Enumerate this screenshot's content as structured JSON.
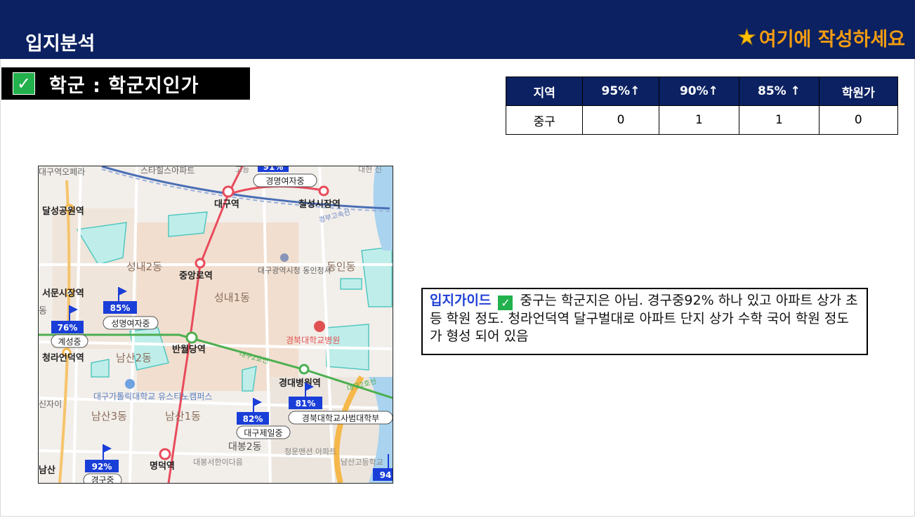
{
  "header": {
    "title": "입지분석",
    "note": "여기에 작성하세요",
    "bg_color": "#0b2161",
    "note_color": "#f39c12",
    "star_icon": "star-icon"
  },
  "section": {
    "label": "학군 : 학군지인가",
    "check_icon": "checkmark-icon"
  },
  "stats_table": {
    "headers": [
      "지역",
      "95%↑",
      "90%↑",
      "85% ↑",
      "학원가"
    ],
    "rows": [
      [
        "중구",
        "0",
        "1",
        "1",
        "0"
      ]
    ]
  },
  "map": {
    "stations": [
      "대구역",
      "칠성시장역",
      "달성공원역",
      "중앙로역",
      "서문시장역",
      "반월당역",
      "청라언덕역",
      "경대병원역",
      "명덕역"
    ],
    "districts": [
      "성내2동",
      "성내1동",
      "동인동",
      "남산2동",
      "남산3동",
      "남산1동",
      "대봉2동"
    ],
    "landmarks": [
      "대구광역시청 동인청사",
      "경북대학교병원",
      "대구가톨릭대학교 유스티노캠퍼스",
      "청운맨션 아파트",
      "대봉서한이다음",
      "남산고등학교",
      "스타힐스아파트",
      "대구역오페라",
      "경부고속선",
      "대구2호선",
      "대구2호선"
    ],
    "schools": [
      {
        "rate": "85%",
        "name": "성명여자중"
      },
      {
        "rate": "76%",
        "name": "계성중"
      },
      {
        "rate": "82%",
        "name": "대구제일중"
      },
      {
        "rate": "81%",
        "name": "경북대학교사범대학부"
      },
      {
        "rate": "92%",
        "name": "경구중"
      },
      {
        "rate": "91%",
        "name": "경명여자중"
      },
      {
        "rate": "94",
        "name": ""
      }
    ],
    "edge_labels": [
      "동",
      "남산",
      "신자이",
      "대현 신",
      "고등"
    ]
  },
  "guide": {
    "title": "입지가이드",
    "text": "중구는 학군지은 아님. 경구중92% 하나 있고 아파트 상가 초등 학원 정도. 청라언덕역 달구벌대로 아파트 단지 상가 수학 국어 학원 정도가 형성 되어 있음"
  }
}
